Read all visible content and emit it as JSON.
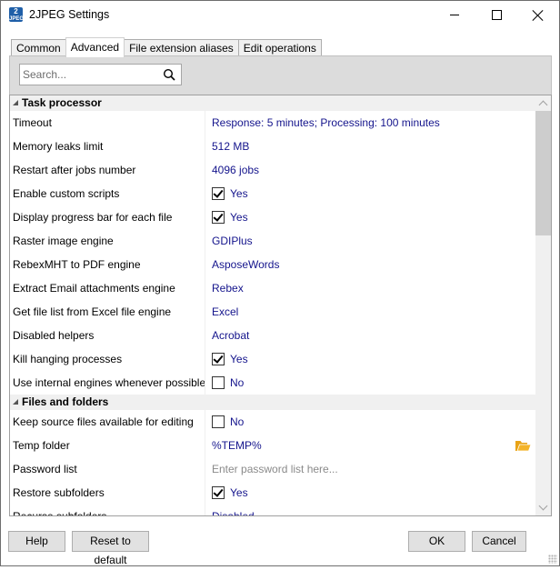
{
  "window": {
    "title": "2JPEG Settings",
    "icon": {
      "top": "2",
      "bottom": "JPEG"
    },
    "controls": {
      "minimize": "minimize-icon",
      "maximize": "maximize-icon",
      "close": "close-icon"
    }
  },
  "tabs": [
    {
      "label": "Common",
      "active": false
    },
    {
      "label": "Advanced",
      "active": true
    },
    {
      "label": "File extension aliases",
      "active": false
    },
    {
      "label": "Edit operations",
      "active": false
    }
  ],
  "search": {
    "placeholder": "Search...",
    "value": "",
    "icon": "search-icon"
  },
  "grid": {
    "categories": [
      {
        "label": "Task processor",
        "expanded": true,
        "rows": [
          {
            "name": "Timeout",
            "value": "Response: 5 minutes; Processing: 100 minutes"
          },
          {
            "name": "Memory leaks limit",
            "value": "512 MB"
          },
          {
            "name": "Restart after jobs number",
            "value": "4096 jobs"
          },
          {
            "name": "Enable custom scripts",
            "value": "Yes",
            "checkbox": true,
            "checked": true
          },
          {
            "name": "Display progress bar for each file",
            "value": "Yes",
            "checkbox": true,
            "checked": true
          },
          {
            "name": "Raster image engine",
            "value": "GDIPlus"
          },
          {
            "name": "RebexMHT to PDF engine",
            "value": "AsposeWords"
          },
          {
            "name": "Extract Email attachments engine",
            "value": "Rebex"
          },
          {
            "name": "Get file list from Excel file engine",
            "value": "Excel"
          },
          {
            "name": "Disabled helpers",
            "value": "Acrobat"
          },
          {
            "name": "Kill hanging processes",
            "value": "Yes",
            "checkbox": true,
            "checked": true
          },
          {
            "name": "Use internal engines whenever possible",
            "value": "No",
            "checkbox": true,
            "checked": false
          }
        ]
      },
      {
        "label": "Files and folders",
        "expanded": true,
        "rows": [
          {
            "name": "Keep source files available for editing",
            "value": "No",
            "checkbox": true,
            "checked": false
          },
          {
            "name": "Temp folder",
            "value": "%TEMP%",
            "browse_icon": "folder-open-icon"
          },
          {
            "name": "Password list",
            "value": "",
            "placeholder": "Enter password list here..."
          },
          {
            "name": "Restore subfolders",
            "value": "Yes",
            "checkbox": true,
            "checked": true
          },
          {
            "name": "Recurse subfolders",
            "value": "Disabled"
          }
        ]
      }
    ],
    "colors": {
      "value_text": "#14148c",
      "placeholder_text": "#8a8a8a",
      "category_bg": "#f0f0f0"
    }
  },
  "buttons": {
    "help": "Help",
    "reset": "Reset to default",
    "ok": "OK",
    "cancel": "Cancel"
  }
}
